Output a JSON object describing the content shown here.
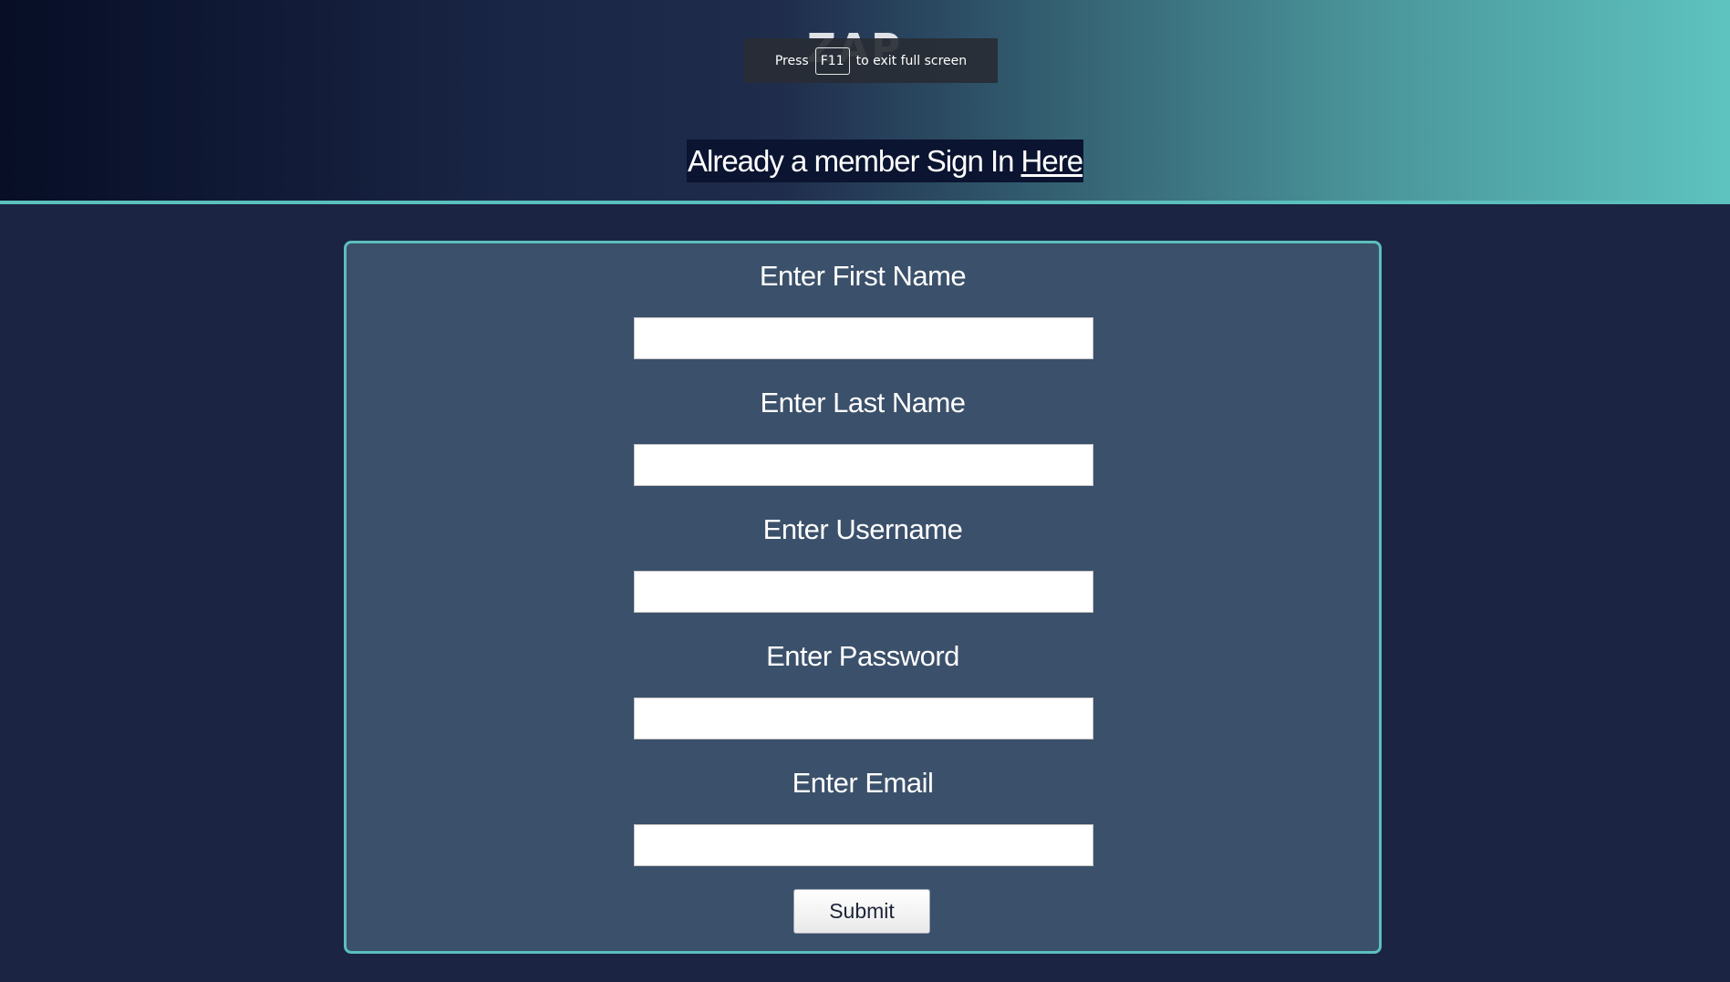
{
  "header": {
    "logo_text": "ZAP",
    "member_text": "Already a member Sign In",
    "member_link": "Here"
  },
  "fullscreen_toast": {
    "prefix": "Press",
    "key": "F11",
    "suffix": "to exit full screen"
  },
  "form": {
    "fields": [
      {
        "label": "Enter First Name",
        "value": ""
      },
      {
        "label": "Enter Last Name",
        "value": ""
      },
      {
        "label": "Enter Username",
        "value": ""
      },
      {
        "label": "Enter Password",
        "value": ""
      },
      {
        "label": "Enter Email",
        "value": ""
      }
    ],
    "submit_label": "Submit"
  },
  "colors": {
    "page_background": "#1b2442",
    "card_background": "#3b506a",
    "accent": "#5bbfbd"
  }
}
